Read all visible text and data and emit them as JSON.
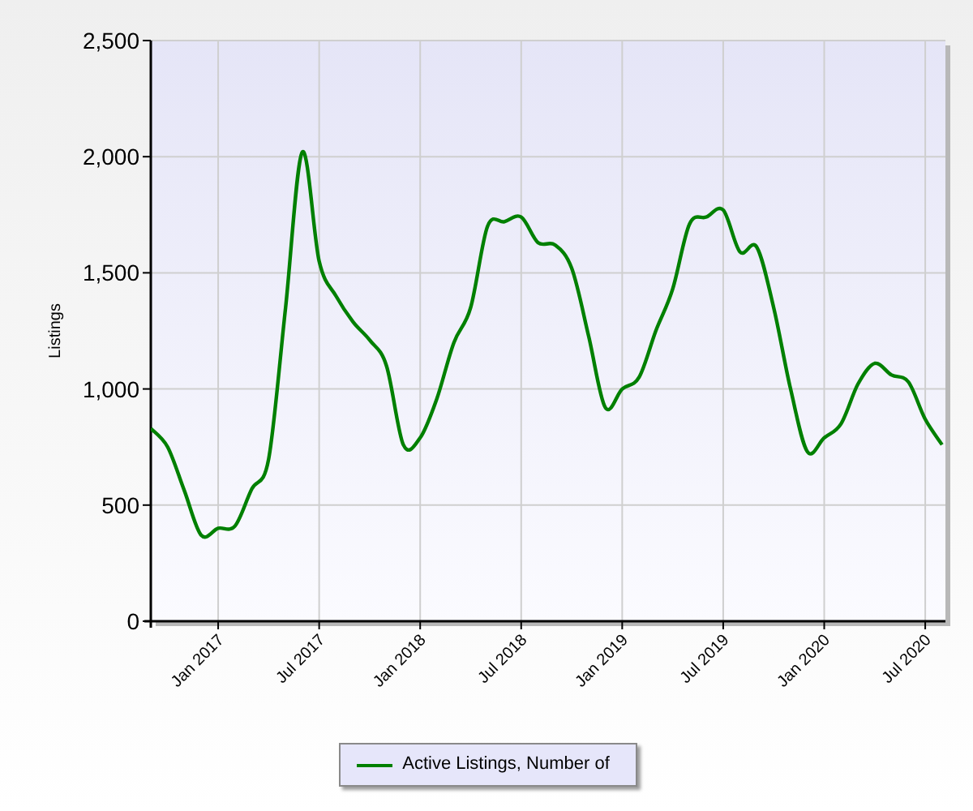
{
  "chart_data": {
    "type": "line",
    "ylabel": "Listings",
    "categories": [
      null,
      null,
      null,
      null,
      "Jan 2017",
      null,
      null,
      null,
      null,
      null,
      "Jul 2017",
      null,
      null,
      null,
      null,
      null,
      "Jan 2018",
      null,
      null,
      null,
      null,
      null,
      "Jul 2018",
      null,
      null,
      null,
      null,
      null,
      "Jan 2019",
      null,
      null,
      null,
      null,
      null,
      "Jul 2019",
      null,
      null,
      null,
      null,
      null,
      "Jan 2020",
      null,
      null,
      null,
      null,
      null,
      "Jul 2020",
      null
    ],
    "series": [
      {
        "name": "Active Listings, Number of",
        "color": "#008000",
        "values": [
          830,
          750,
          560,
          370,
          400,
          410,
          570,
          700,
          1350,
          2020,
          1550,
          1400,
          1290,
          1210,
          1100,
          760,
          790,
          960,
          1200,
          1350,
          1700,
          1720,
          1740,
          1630,
          1620,
          1520,
          1230,
          920,
          1000,
          1050,
          1250,
          1430,
          1710,
          1740,
          1770,
          1590,
          1610,
          1350,
          1000,
          730,
          790,
          850,
          1020,
          1110,
          1060,
          1030,
          870,
          760
        ]
      }
    ],
    "ylim": [
      0,
      2500
    ],
    "grid": true,
    "yticks": [
      {
        "value": 0,
        "label": "0"
      },
      {
        "value": 500,
        "label": "500"
      },
      {
        "value": 1000,
        "label": "1,000"
      },
      {
        "value": 1500,
        "label": "1,500"
      },
      {
        "value": 2000,
        "label": "2,000"
      },
      {
        "value": 2500,
        "label": "2,500"
      }
    ]
  }
}
